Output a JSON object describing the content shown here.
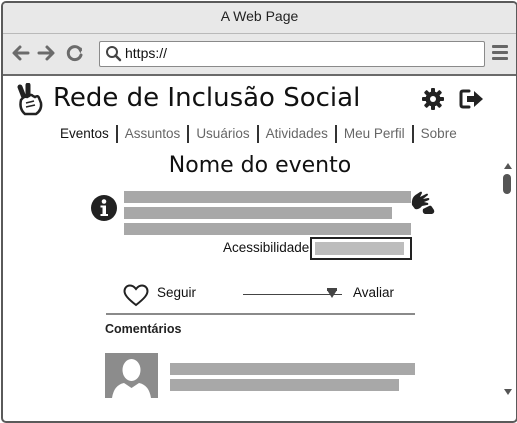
{
  "window": {
    "title": "A Web Page"
  },
  "toolbar": {
    "url": "https://"
  },
  "site": {
    "title": "Rede de Inclusão Social"
  },
  "nav": {
    "tabs": [
      {
        "label": "Eventos",
        "active": true
      },
      {
        "label": "Assuntos"
      },
      {
        "label": "Usuários"
      },
      {
        "label": "Atividades"
      },
      {
        "label": "Meu Perfil"
      },
      {
        "label": "Sobre"
      }
    ]
  },
  "event": {
    "name": "Nome do evento",
    "accessibility_label": "Acessibilidade",
    "follow_label": "Seguir",
    "rate_label": "Avaliar",
    "rating_fraction": 0.9
  },
  "comments": {
    "title": "Comentários"
  },
  "icons": {
    "logo": "victory-hand-icon",
    "settings": "gear-icon",
    "logout": "logout-icon",
    "info": "info-icon",
    "signs": "sign-language-icon",
    "heart": "heart-outline-icon",
    "avatar": "user-avatar-icon"
  },
  "colors": {
    "placeholder": "#a8a8a8",
    "chrome": "#e8e8e8",
    "text": "#111111"
  }
}
